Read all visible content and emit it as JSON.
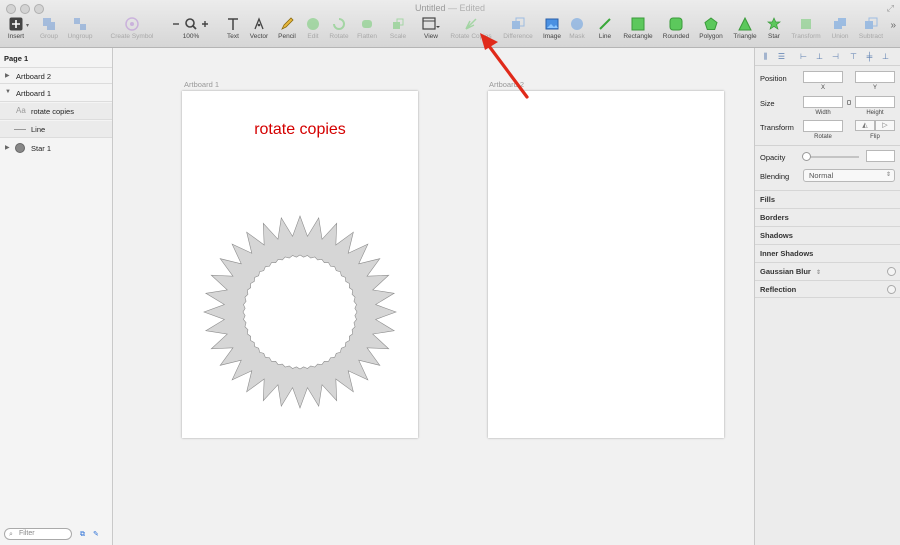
{
  "window": {
    "title": "Untitled",
    "status": "— Edited"
  },
  "toolbar": {
    "items": [
      {
        "id": "insert",
        "label": "Insert",
        "icon": "plus-icon",
        "enabled": true
      },
      {
        "id": "group",
        "label": "Group",
        "icon": "group-icon",
        "enabled": false
      },
      {
        "id": "ungroup",
        "label": "Ungroup",
        "icon": "ungroup-icon",
        "enabled": false
      },
      {
        "id": "create-symbol",
        "label": "Create Symbol",
        "icon": "symbol-icon",
        "enabled": false
      },
      {
        "id": "zoom",
        "label": "100%",
        "icon": "zoom-icon",
        "enabled": true
      },
      {
        "id": "text",
        "label": "Text",
        "icon": "text-icon",
        "enabled": true
      },
      {
        "id": "vector",
        "label": "Vector",
        "icon": "vector-pen-icon",
        "enabled": true
      },
      {
        "id": "pencil",
        "label": "Pencil",
        "icon": "pencil-icon",
        "enabled": true
      },
      {
        "id": "edit",
        "label": "Edit",
        "icon": "edit-icon",
        "enabled": false
      },
      {
        "id": "rotate",
        "label": "Rotate",
        "icon": "rotate-icon",
        "enabled": false
      },
      {
        "id": "flatten",
        "label": "Flatten",
        "icon": "flatten-icon",
        "enabled": false
      },
      {
        "id": "scale",
        "label": "Scale",
        "icon": "scale-icon",
        "enabled": false
      },
      {
        "id": "view",
        "label": "View",
        "icon": "view-icon",
        "enabled": true
      },
      {
        "id": "rotate-copies",
        "label": "Rotate Copies",
        "icon": "rotate-copies-icon",
        "enabled": false
      },
      {
        "id": "difference",
        "label": "Difference",
        "icon": "difference-icon",
        "enabled": false
      },
      {
        "id": "image",
        "label": "Image",
        "icon": "image-icon",
        "enabled": true
      },
      {
        "id": "mask",
        "label": "Mask",
        "icon": "mask-icon",
        "enabled": false
      },
      {
        "id": "line",
        "label": "Line",
        "icon": "line-icon",
        "enabled": true
      },
      {
        "id": "rectangle",
        "label": "Rectangle",
        "icon": "rectangle-icon",
        "enabled": true
      },
      {
        "id": "rounded",
        "label": "Rounded",
        "icon": "rounded-rectangle-icon",
        "enabled": true
      },
      {
        "id": "polygon",
        "label": "Polygon",
        "icon": "polygon-icon",
        "enabled": true
      },
      {
        "id": "triangle",
        "label": "Triangle",
        "icon": "triangle-icon",
        "enabled": true
      },
      {
        "id": "star",
        "label": "Star",
        "icon": "star-icon",
        "enabled": true
      },
      {
        "id": "transform",
        "label": "Transform",
        "icon": "transform-icon",
        "enabled": false
      },
      {
        "id": "union",
        "label": "Union",
        "icon": "union-icon",
        "enabled": false
      },
      {
        "id": "subtract",
        "label": "Subtract",
        "icon": "subtract-icon",
        "enabled": false
      }
    ]
  },
  "layers": {
    "page": "Page 1",
    "rows": [
      {
        "name": "Artboard 2",
        "expanded": false,
        "level": 0
      },
      {
        "name": "Artboard 1",
        "expanded": true,
        "level": 0
      },
      {
        "name": "rotate copies",
        "level": 1,
        "icon": "text-layer-icon"
      },
      {
        "name": "Line",
        "level": 1,
        "icon": "line-layer-icon"
      },
      {
        "name": "Star 1",
        "expanded": false,
        "level": 0,
        "icon": "shape-layer-icon"
      }
    ],
    "filter_placeholder": "Filter"
  },
  "canvas": {
    "artboard1_label": "Artboard 1",
    "artboard2_label": "Artboard 2",
    "text": "rotate copies",
    "text_color": "#d40000"
  },
  "inspector": {
    "position_label": "Position",
    "x_label": "X",
    "y_label": "Y",
    "size_label": "Size",
    "width_label": "Width",
    "height_label": "Height",
    "transform_label": "Transform",
    "rotate_label": "Rotate",
    "flip_label": "Flip",
    "opacity_label": "Opacity",
    "blending_label": "Blending",
    "blending_value": "Normal",
    "sections": [
      "Fills",
      "Borders",
      "Shadows",
      "Inner Shadows",
      "Gaussian Blur",
      "Reflection"
    ]
  },
  "colors": {
    "accent_green": "#5cc85c",
    "accent_blue": "#4a90e2",
    "arrow_red": "#e02a1a"
  }
}
